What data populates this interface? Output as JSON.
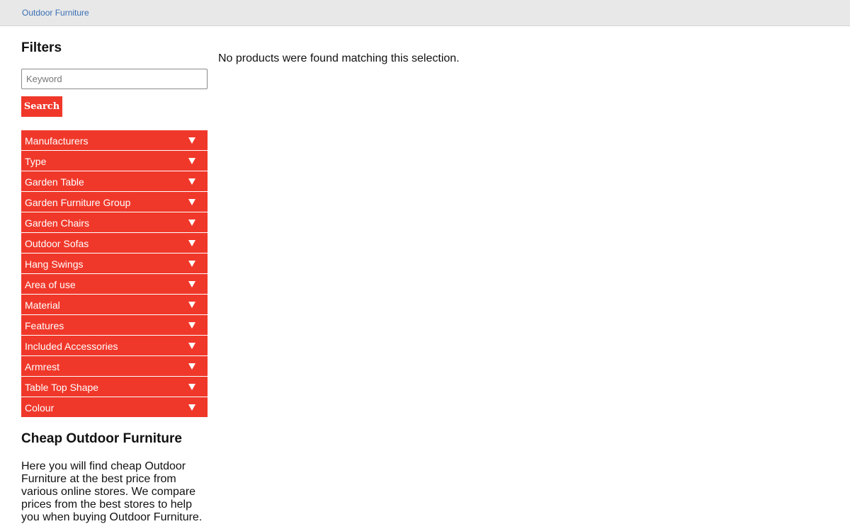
{
  "header": {
    "breadcrumb": "Outdoor Furniture"
  },
  "sidebar": {
    "title": "Filters",
    "search": {
      "placeholder": "Keyword",
      "value": "",
      "button_label": "Search"
    },
    "filters": [
      "Manufacturers",
      "Type",
      "Garden Table",
      "Garden Furniture Group",
      "Garden Chairs",
      "Outdoor Sofas",
      "Hang Swings",
      "Area of use",
      "Material",
      "Features",
      "Included Accessories",
      "Armrest",
      "Table Top Shape",
      "Colour"
    ],
    "info": {
      "heading": "Cheap Outdoor Furniture",
      "text": "Here you will find cheap Outdoor Furniture at the best price from various online stores. We compare prices from the best stores to help you when buying Outdoor Furniture."
    }
  },
  "main": {
    "message": "No products were found matching this selection."
  },
  "colors": {
    "accent": "#f0382a",
    "topbar": "#e8e8e8",
    "link": "#3a6fb5"
  },
  "icons": {
    "filter_toggle": "chevron-down-icon"
  }
}
